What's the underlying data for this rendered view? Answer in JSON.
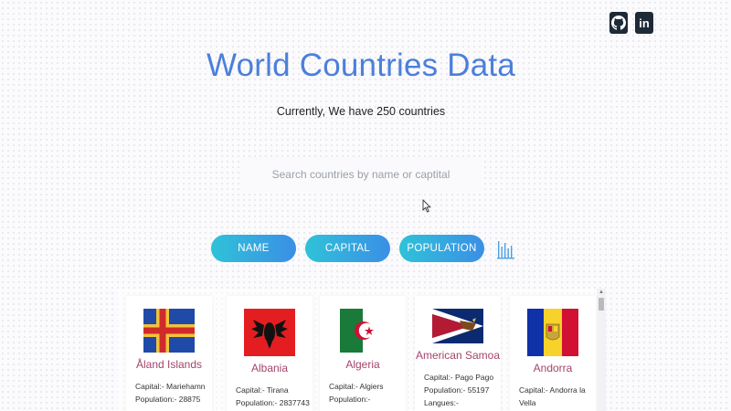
{
  "header": {
    "title": "World Countries Data",
    "subtitle": "Currently, We have 250 countries"
  },
  "social": {
    "github_icon": "github-icon",
    "linkedin_icon": "linkedin-icon",
    "linkedin_text": "in"
  },
  "search": {
    "placeholder": "Search countries by name or captital",
    "value": ""
  },
  "sort_buttons": {
    "name": "NAME",
    "capital": "CAPITAL",
    "population": "POPULATION",
    "chart_icon": "bar-chart-icon"
  },
  "countries": [
    {
      "name": "Åland Islands",
      "capital": "Capital:- Mariehamn",
      "population": "Population:- 28875",
      "extra": ""
    },
    {
      "name": "Albania",
      "capital": "Capital:- Tirana",
      "population": "Population:- 2837743",
      "extra": ""
    },
    {
      "name": "Algeria",
      "capital": "Capital:- Algiers",
      "population": "Population:-",
      "extra": ""
    },
    {
      "name": "American Samoa",
      "capital": "Capital:- Pago Pago",
      "population": "Population:- 55197",
      "extra": "Langues:-"
    },
    {
      "name": "Andorra",
      "capital": "Capital:- Andorra la",
      "population": "Vella",
      "extra": ""
    }
  ],
  "colors": {
    "title": "#4c7fdb",
    "country_name": "#a3446a",
    "button_gradient_start": "#2fc2d8",
    "button_gradient_end": "#3a8fe6"
  }
}
